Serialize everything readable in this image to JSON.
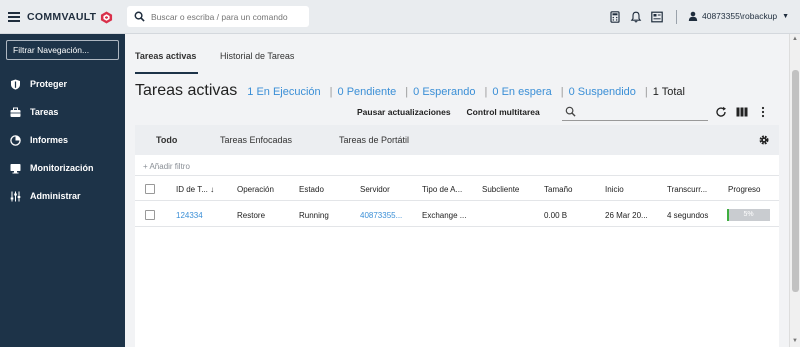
{
  "header": {
    "brand": "COMMVAULT",
    "search_placeholder": "Buscar o escriba / para un comando",
    "user": "40873355\\robackup"
  },
  "sidebar": {
    "filter_placeholder": "Filtrar Navegación...",
    "items": [
      {
        "label": "Proteger",
        "icon": "shield-icon"
      },
      {
        "label": "Tareas",
        "icon": "briefcase-icon"
      },
      {
        "label": "Informes",
        "icon": "chart-icon"
      },
      {
        "label": "Monitorización",
        "icon": "monitor-icon"
      },
      {
        "label": "Administrar",
        "icon": "settings-icon"
      }
    ]
  },
  "main": {
    "tabs": [
      "Tareas activas",
      "Historial de Tareas"
    ],
    "active_tab": "Tareas activas",
    "title": "Tareas activas",
    "stats": [
      {
        "count": "1",
        "label": "En Ejecución"
      },
      {
        "count": "0",
        "label": "Pendiente"
      },
      {
        "count": "0",
        "label": "Esperando"
      },
      {
        "count": "0",
        "label": "En espera"
      },
      {
        "count": "0",
        "label": "Suspendido"
      },
      {
        "count": "1",
        "label": "Total"
      }
    ],
    "actions": {
      "pause": "Pausar actualizaciones",
      "multitask": "Control multitarea"
    },
    "subtabs": [
      "Todo",
      "Tareas Enfocadas",
      "Tareas de Portátil"
    ],
    "add_filter": "+ Añadir filtro",
    "columns": [
      "ID de T...",
      "Operación",
      "Estado",
      "Servidor",
      "Tipo de A...",
      "Subcliente",
      "Tamaño",
      "Inicio",
      "Transcurr...",
      "Progreso"
    ],
    "rows": [
      {
        "id": "124334",
        "operation": "Restore",
        "state": "Running",
        "server": "40873355...",
        "type": "Exchange ...",
        "subclient": "",
        "size": "0.00 B",
        "start": "26 Mar 20...",
        "elapsed": "4 segundos",
        "progress_pct": 5,
        "progress_label": "5%"
      }
    ]
  },
  "colors": {
    "sidebar_bg": "#1d3348",
    "accent_blue": "#3b8fd6",
    "progress_green": "#3fae3f",
    "brand_red": "#d9304a"
  }
}
